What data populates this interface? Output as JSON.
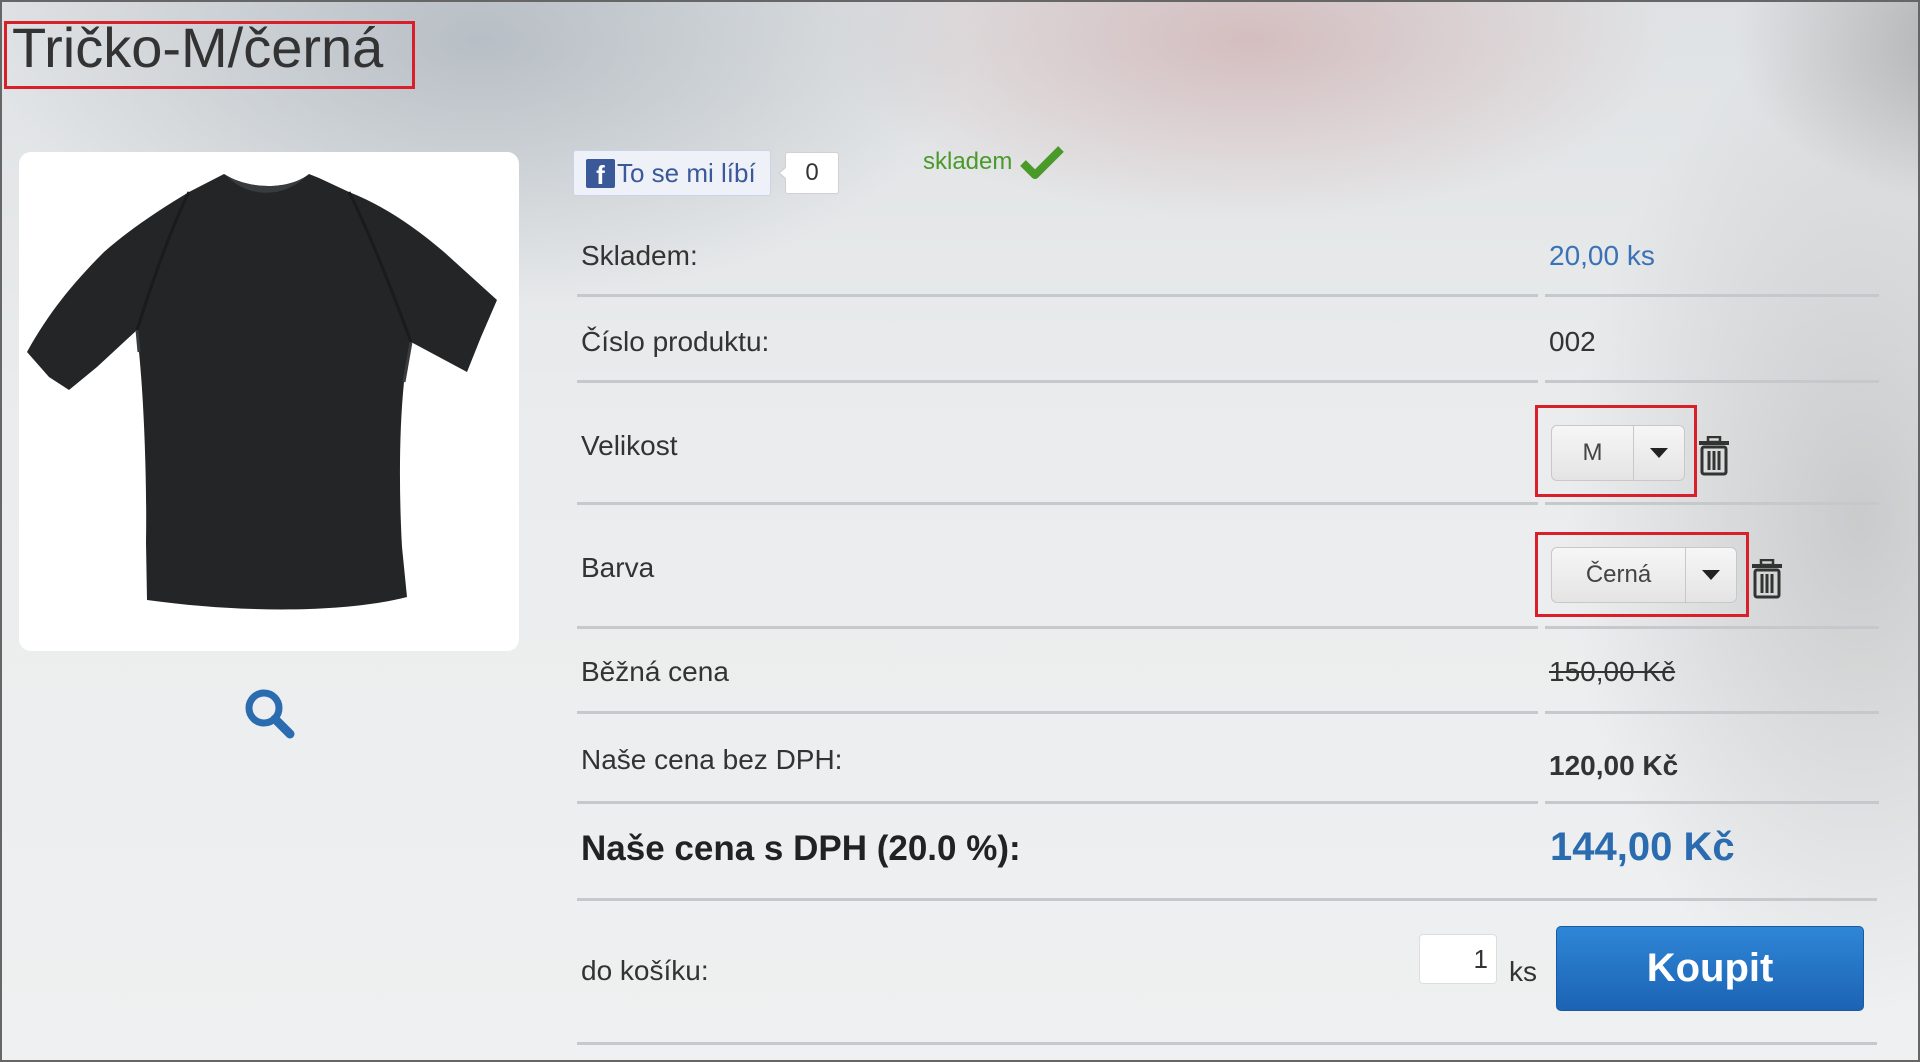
{
  "product": {
    "title": "Tričko-M/černá"
  },
  "social": {
    "like_label": "To se mi líbí",
    "like_count": "0"
  },
  "stock": {
    "status_text": "skladem"
  },
  "details": {
    "stock_label": "Skladem:",
    "stock_value": "20,00 ks",
    "product_number_label": "Číslo produktu:",
    "product_number_value": "002",
    "size_label": "Velikost",
    "size_selected": "M",
    "color_label": "Barva",
    "color_selected": "Černá",
    "regular_price_label": "Běžná cena",
    "regular_price_value": "150,00 Kč",
    "price_without_vat_label": "Naše cena bez DPH:",
    "price_without_vat_value": "120,00 Kč",
    "price_with_vat_label": "Naše cena s DPH (20.0 %):",
    "price_with_vat_value": "144,00 Kč"
  },
  "cart": {
    "label": "do košíku:",
    "quantity": "1",
    "unit": "ks",
    "buy_label": "Koupit"
  },
  "colors": {
    "accent_blue": "#2b6bb0",
    "highlight_red": "#d9202a",
    "stock_green": "#4a9a2a",
    "facebook_blue": "#3b5998"
  },
  "icons": [
    "search-icon",
    "trash-icon",
    "checkmark-icon",
    "facebook-icon",
    "chevron-down-icon"
  ]
}
